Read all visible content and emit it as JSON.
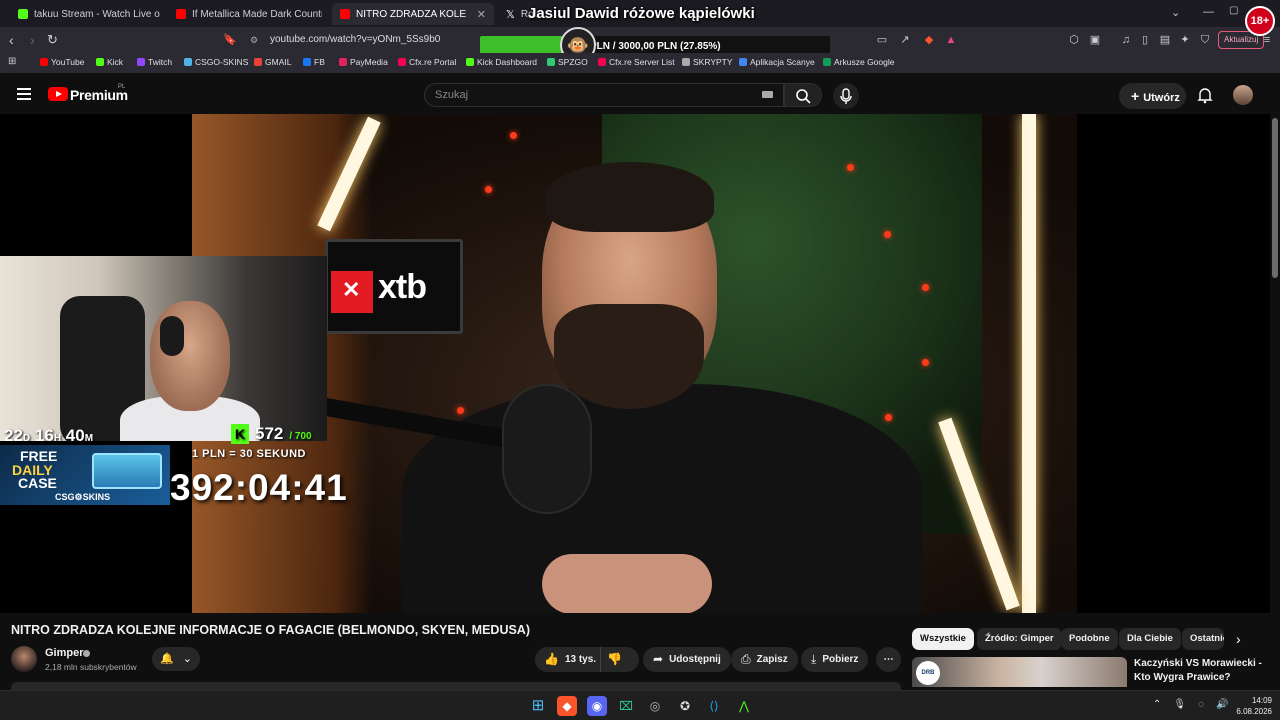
{
  "browser": {
    "tabs": [
      {
        "title": "takuu Stream - Watch Live on Kic",
        "color": "#53fc18",
        "active": false
      },
      {
        "title": "If Metallica Made Dark Country (Seeb",
        "color": "#ff0000",
        "active": false
      },
      {
        "title": "NITRO ZDRADZA KOLEJNE INFO",
        "color": "#ff0000",
        "active": true
      },
      {
        "title": "Roc",
        "color": "#000000",
        "active": false
      }
    ],
    "url": "youtube.com/watch?v=yONm_5Ss9b0",
    "update_button": "Aktualizuj",
    "bookmarks": [
      {
        "label": "YouTube",
        "color": "#ff0000"
      },
      {
        "label": "Kick",
        "color": "#53fc18"
      },
      {
        "label": "Twitch",
        "color": "#9146ff"
      },
      {
        "label": "CSGO-SKINS",
        "color": "#4fb3e8"
      },
      {
        "label": "GMAIL",
        "color": "#ea4335"
      },
      {
        "label": "FB",
        "color": "#1877f2"
      },
      {
        "label": "PayMedia",
        "color": "#e0245e"
      },
      {
        "label": "Cfx.re Portal",
        "color": "#f40552"
      },
      {
        "label": "Kick Dashboard",
        "color": "#53fc18"
      },
      {
        "label": "SPZGO",
        "color": "#2ecc71"
      },
      {
        "label": "Cfx.re Server List",
        "color": "#f40552"
      },
      {
        "label": "SKRYPTY",
        "color": "#aaaaaa"
      },
      {
        "label": "Aplikacja Scanye",
        "color": "#4285f4"
      },
      {
        "label": "Arkusze Google",
        "color": "#0f9d58"
      }
    ]
  },
  "stream_overlay": {
    "title": "Jasiul Dawid różowe kąpielówki",
    "goal_text": "PLN / 3000,00 PLN  (27.85%)",
    "goal_fraction": 0.2785,
    "age_badge": "18+",
    "countdown_days": "22",
    "countdown_d": "D",
    "countdown_hours": "16",
    "countdown_h": "H",
    "countdown_minutes": "40",
    "countdown_m": "M",
    "kick_count": "572",
    "kick_goal": "/ 700",
    "rate": "1 PLN = 30 SEKUND",
    "big_timer": "392:04:41",
    "promo_line1": "FREE",
    "promo_line2": "DAILY",
    "promo_line3": "CASE",
    "promo_brand": "CSG⚙SKINS"
  },
  "youtube": {
    "brand": "Premium",
    "region": "PL",
    "search_placeholder": "Szukaj",
    "create_label": "Utwórz",
    "video_title": "NITRO ZDRADZA KOLEJNE INFORMACJE O FAGACIE (BELMONDO, SKYEN, MEDUSA)",
    "video_sign": "xtb",
    "channel_name": "Gimper",
    "channel_subs": "2,18 mln subskrybentów",
    "likes": "13 tys.",
    "share_label": "Udostępnij",
    "save_label": "Zapisz",
    "download_label": "Pobierz",
    "chips": [
      "Wszystkie",
      "Źródło: Gimper",
      "Podobne",
      "Dla Ciebie",
      "Ostatnio"
    ],
    "rec_title": "Kaczyński VS Morawiecki - Kto Wygra Prawice?",
    "rec_logo": "DRB"
  },
  "taskbar": {
    "time": "14:09",
    "date": "6.08.2026"
  }
}
